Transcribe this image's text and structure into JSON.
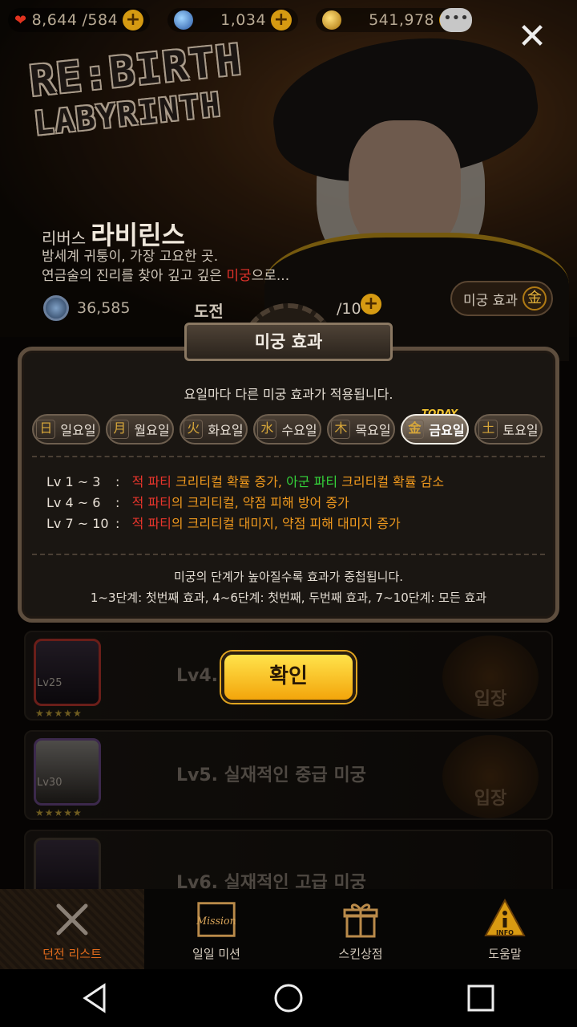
{
  "status": {
    "stamina": "8,644",
    "stamina_max": "/584",
    "gems": "1,034",
    "gold": "541,978"
  },
  "dungeon": {
    "logo_line1": "RE:BIRTH",
    "logo_line2": "LABYRINTH",
    "title_small": "리버스",
    "title_big": "라비린스",
    "desc_line1": "밤세계 귀퉁이, 가장 고요한 곳.",
    "desc_line2_pre": "연금술의 진리를 찾아 깊고 깊은 ",
    "desc_line2_red": "미궁",
    "desc_line2_post": "으로...",
    "energy": "36,585",
    "try_label": "도전",
    "try_count": "/10",
    "effect_chip": "미궁 효과",
    "effect_hanja": "金"
  },
  "modal": {
    "title": "미궁 효과",
    "subtitle": "요일마다 다른 미궁 효과가 적용됩니다.",
    "today_badge": "TODAY",
    "days": [
      {
        "hanja": "日",
        "label": "일요일",
        "active": false
      },
      {
        "hanja": "月",
        "label": "월요일",
        "active": false
      },
      {
        "hanja": "火",
        "label": "화요일",
        "active": false
      },
      {
        "hanja": "水",
        "label": "수요일",
        "active": false
      },
      {
        "hanja": "木",
        "label": "목요일",
        "active": false
      },
      {
        "hanja": "金",
        "label": "금요일",
        "active": true
      },
      {
        "hanja": "土",
        "label": "토요일",
        "active": false
      }
    ],
    "levels": [
      {
        "lv": "Lv 1 ~ 3",
        "sep": ":",
        "p1": "적 파티",
        "p2": " 크리티컬 확률 증가,",
        "p3": " 아군 파티",
        "p4": " 크리티컬 확률 감소"
      },
      {
        "lv": "Lv 4 ~ 6",
        "sep": ":",
        "p1": "적 파티",
        "p2": "의 크리티컬, 약점 피해 방어 증가"
      },
      {
        "lv": "Lv 7 ~ 10",
        "sep": ":",
        "p1": "적 파티",
        "p2": "의 크리티컬 대미지, 약점 피해 대미지 증가"
      }
    ],
    "note_line1": "미궁의 단계가 높아질수록 효과가 중첩됩니다.",
    "note_line2": "1~3단계: 첫번째 효과, 4~6단계: 첫번째, 두번째 효과, 7~10단계: 모든 효과",
    "confirm": "확인"
  },
  "rows": [
    {
      "name": "Lv4. 실",
      "lvtag": "Lv25",
      "stars": "★★★★★",
      "enter": "입장"
    },
    {
      "name": "Lv5. 실재적인 중급 미궁",
      "lvtag": "Lv30",
      "stars": "★★★★★",
      "enter": "입장"
    },
    {
      "name": "Lv6. 실재적인 고급 미궁",
      "lvtag": "",
      "stars": "",
      "enter": ""
    }
  ],
  "side_enter": [
    "입장",
    "입장"
  ],
  "tabs": [
    {
      "label": "던전 리스트",
      "icon": "crossed-swords-icon"
    },
    {
      "label": "일일 미션",
      "icon": "mission-icon"
    },
    {
      "label": "스킨상점",
      "icon": "gift-icon"
    },
    {
      "label": "도움말",
      "icon": "info-icon"
    }
  ],
  "tab_icon_text": {
    "mission": "Mission",
    "info": "INFO"
  },
  "colors": {
    "accent": "#f3a50b",
    "danger": "#e8352c",
    "ally": "#35d43a",
    "effect": "#f19a1e"
  }
}
